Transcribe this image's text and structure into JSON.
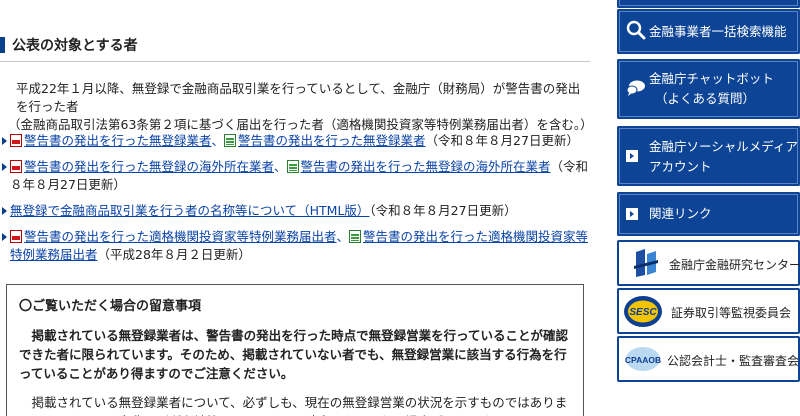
{
  "section": {
    "title": "公表の対象とする者"
  },
  "intro": {
    "line1": "平成22年１月以降、無登録で金融商品取引業を行っているとして、金融庁（財務局）が警告書の発出を行った者",
    "line2": "（金融商品取引法第63条第２項に基づく届出を行った者（適格機関投資家等特例業務届出者）を含む。）"
  },
  "links": [
    {
      "pdf": "警告書の発出を行った無登録業者",
      "sep": "、",
      "xls": "警告書の発出を行った無登録業者",
      "note": "（令和８年８月27日更新）"
    },
    {
      "pdf": "警告書の発出を行った無登録の海外所在業者",
      "sep": "、",
      "xls": "警告書の発出を行った無登録の海外所在業者",
      "note": "（令和８年８月27日更新）"
    },
    {
      "html": "無登録で金融商品取引業を行う者の名称等について（HTML版）",
      "note": "（令和８年８月27日更新）"
    },
    {
      "pdf": "警告書の発出を行った適格機関投資家等特例業務届出者",
      "sep": "、",
      "xls": "警告書の発出を行った適格機関投資家等特例業務届出者",
      "note": "（平成28年８月２日更新）"
    }
  ],
  "notice": {
    "heading": "〇ご覧いただく場合の留意事項",
    "p1": "掲載されている無登録業者は、警告書の発出を行った時点で無登録営業を行っていることが確認できた者に限られています。そのため、掲載されていない者でも、無登録営業に該当する行為を行っていることがあり得ますのでご注意ください。",
    "p2": "掲載されている無登録業者について、必ずしも、現在の無登録営業の状況を示すものではありません。また、その名称及び所在地等についても、現時点のものでない場合があります。"
  },
  "sidebar": {
    "search": "金融事業者一括検索機能",
    "chatbot_l1": "金融庁チャットボット",
    "chatbot_l2": "（よくある質問）",
    "social_l1": "金融庁ソーシャルメディア",
    "social_l2": "アカウント",
    "related": "関連リンク",
    "fsa_institute": "金融庁金融研究センター",
    "sesc": "証券取引等監視委員会",
    "cpaaob": "公認会計士・監査審査会",
    "sesc_logo_text": "SESC",
    "cpaaob_logo_text": "CPAAOB"
  },
  "colors": {
    "primary": "#0d4496",
    "link": "#0a43a8",
    "pdf": "#d21414",
    "excel": "#2e7d32"
  }
}
